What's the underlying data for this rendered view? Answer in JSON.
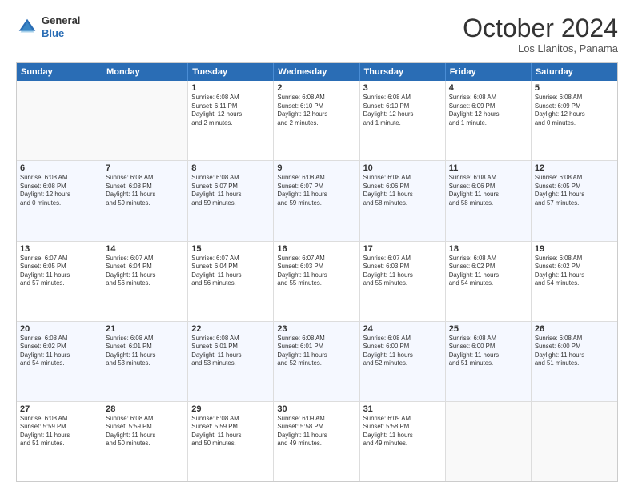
{
  "header": {
    "logo_line1": "General",
    "logo_line2": "Blue",
    "month_title": "October 2024",
    "location": "Los Llanitos, Panama"
  },
  "weekdays": [
    "Sunday",
    "Monday",
    "Tuesday",
    "Wednesday",
    "Thursday",
    "Friday",
    "Saturday"
  ],
  "rows": [
    [
      {
        "day": "",
        "info": ""
      },
      {
        "day": "",
        "info": ""
      },
      {
        "day": "1",
        "info": "Sunrise: 6:08 AM\nSunset: 6:11 PM\nDaylight: 12 hours\nand 2 minutes."
      },
      {
        "day": "2",
        "info": "Sunrise: 6:08 AM\nSunset: 6:10 PM\nDaylight: 12 hours\nand 2 minutes."
      },
      {
        "day": "3",
        "info": "Sunrise: 6:08 AM\nSunset: 6:10 PM\nDaylight: 12 hours\nand 1 minute."
      },
      {
        "day": "4",
        "info": "Sunrise: 6:08 AM\nSunset: 6:09 PM\nDaylight: 12 hours\nand 1 minute."
      },
      {
        "day": "5",
        "info": "Sunrise: 6:08 AM\nSunset: 6:09 PM\nDaylight: 12 hours\nand 0 minutes."
      }
    ],
    [
      {
        "day": "6",
        "info": "Sunrise: 6:08 AM\nSunset: 6:08 PM\nDaylight: 12 hours\nand 0 minutes."
      },
      {
        "day": "7",
        "info": "Sunrise: 6:08 AM\nSunset: 6:08 PM\nDaylight: 11 hours\nand 59 minutes."
      },
      {
        "day": "8",
        "info": "Sunrise: 6:08 AM\nSunset: 6:07 PM\nDaylight: 11 hours\nand 59 minutes."
      },
      {
        "day": "9",
        "info": "Sunrise: 6:08 AM\nSunset: 6:07 PM\nDaylight: 11 hours\nand 59 minutes."
      },
      {
        "day": "10",
        "info": "Sunrise: 6:08 AM\nSunset: 6:06 PM\nDaylight: 11 hours\nand 58 minutes."
      },
      {
        "day": "11",
        "info": "Sunrise: 6:08 AM\nSunset: 6:06 PM\nDaylight: 11 hours\nand 58 minutes."
      },
      {
        "day": "12",
        "info": "Sunrise: 6:08 AM\nSunset: 6:05 PM\nDaylight: 11 hours\nand 57 minutes."
      }
    ],
    [
      {
        "day": "13",
        "info": "Sunrise: 6:07 AM\nSunset: 6:05 PM\nDaylight: 11 hours\nand 57 minutes."
      },
      {
        "day": "14",
        "info": "Sunrise: 6:07 AM\nSunset: 6:04 PM\nDaylight: 11 hours\nand 56 minutes."
      },
      {
        "day": "15",
        "info": "Sunrise: 6:07 AM\nSunset: 6:04 PM\nDaylight: 11 hours\nand 56 minutes."
      },
      {
        "day": "16",
        "info": "Sunrise: 6:07 AM\nSunset: 6:03 PM\nDaylight: 11 hours\nand 55 minutes."
      },
      {
        "day": "17",
        "info": "Sunrise: 6:07 AM\nSunset: 6:03 PM\nDaylight: 11 hours\nand 55 minutes."
      },
      {
        "day": "18",
        "info": "Sunrise: 6:08 AM\nSunset: 6:02 PM\nDaylight: 11 hours\nand 54 minutes."
      },
      {
        "day": "19",
        "info": "Sunrise: 6:08 AM\nSunset: 6:02 PM\nDaylight: 11 hours\nand 54 minutes."
      }
    ],
    [
      {
        "day": "20",
        "info": "Sunrise: 6:08 AM\nSunset: 6:02 PM\nDaylight: 11 hours\nand 54 minutes."
      },
      {
        "day": "21",
        "info": "Sunrise: 6:08 AM\nSunset: 6:01 PM\nDaylight: 11 hours\nand 53 minutes."
      },
      {
        "day": "22",
        "info": "Sunrise: 6:08 AM\nSunset: 6:01 PM\nDaylight: 11 hours\nand 53 minutes."
      },
      {
        "day": "23",
        "info": "Sunrise: 6:08 AM\nSunset: 6:01 PM\nDaylight: 11 hours\nand 52 minutes."
      },
      {
        "day": "24",
        "info": "Sunrise: 6:08 AM\nSunset: 6:00 PM\nDaylight: 11 hours\nand 52 minutes."
      },
      {
        "day": "25",
        "info": "Sunrise: 6:08 AM\nSunset: 6:00 PM\nDaylight: 11 hours\nand 51 minutes."
      },
      {
        "day": "26",
        "info": "Sunrise: 6:08 AM\nSunset: 6:00 PM\nDaylight: 11 hours\nand 51 minutes."
      }
    ],
    [
      {
        "day": "27",
        "info": "Sunrise: 6:08 AM\nSunset: 5:59 PM\nDaylight: 11 hours\nand 51 minutes."
      },
      {
        "day": "28",
        "info": "Sunrise: 6:08 AM\nSunset: 5:59 PM\nDaylight: 11 hours\nand 50 minutes."
      },
      {
        "day": "29",
        "info": "Sunrise: 6:08 AM\nSunset: 5:59 PM\nDaylight: 11 hours\nand 50 minutes."
      },
      {
        "day": "30",
        "info": "Sunrise: 6:09 AM\nSunset: 5:58 PM\nDaylight: 11 hours\nand 49 minutes."
      },
      {
        "day": "31",
        "info": "Sunrise: 6:09 AM\nSunset: 5:58 PM\nDaylight: 11 hours\nand 49 minutes."
      },
      {
        "day": "",
        "info": ""
      },
      {
        "day": "",
        "info": ""
      }
    ]
  ]
}
